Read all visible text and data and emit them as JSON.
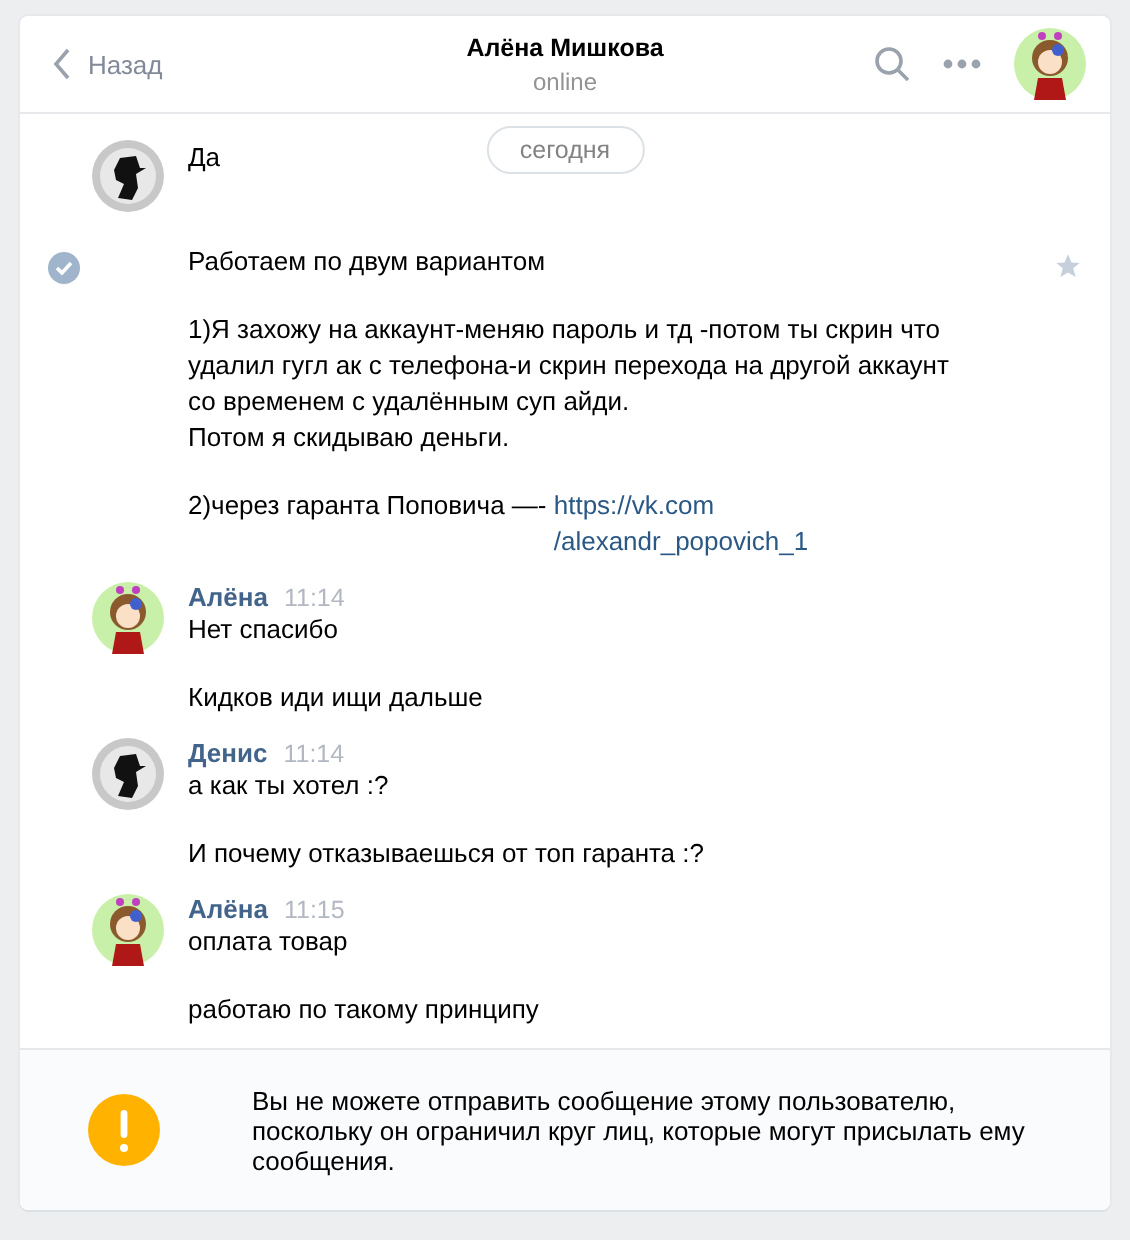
{
  "header": {
    "back": "Назад",
    "title": "Алёна Мишкова",
    "status": "online"
  },
  "date_badge": "сегодня",
  "messages": [
    {
      "kind": "silhouette",
      "checked": false,
      "paragraphs": [
        {
          "text": "Да"
        }
      ]
    },
    {
      "kind": "continuation",
      "checked": true,
      "paragraphs": [
        {
          "text": "Работаем по двум вариантом"
        },
        {
          "text": "1)Я захожу на аккаунт-меняю пароль и тд -потом ты скрин что удалил гугл ак с телефона-и скрин перехода на другой аккаунт со временем с удалённым суп айди.\nПотом я скидываю деньги."
        },
        {
          "text": "2)через гаранта Поповича —- ",
          "link": "https://vk.com\n/alexandr_popovich_1"
        }
      ]
    },
    {
      "kind": "girl",
      "author": "Алёна",
      "time": "11:14",
      "checked": false,
      "paragraphs": [
        {
          "text": "Нет спасибо"
        },
        {
          "text": "Кидков иди ищи дальше"
        }
      ]
    },
    {
      "kind": "silhouette",
      "author": "Денис",
      "time": "11:14",
      "checked": false,
      "paragraphs": [
        {
          "text": "а как ты хотел :?"
        },
        {
          "text": "И почему отказываешься от топ гаранта :?"
        }
      ]
    },
    {
      "kind": "girl",
      "author": "Алёна",
      "time": "11:15",
      "checked": false,
      "paragraphs": [
        {
          "text": "оплата товар"
        },
        {
          "text": "работаю по такому принципу"
        }
      ]
    }
  ],
  "notice": "Вы не можете отправить сообщение этому пользователю, поскольку он ограничил круг лиц, которые могут присылать ему сообщения."
}
